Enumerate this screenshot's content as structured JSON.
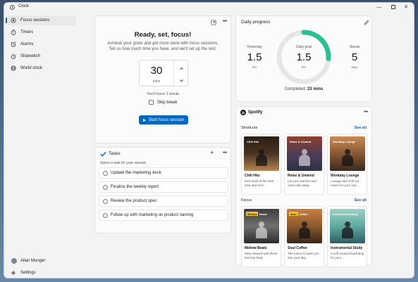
{
  "window": {
    "title": "Clock",
    "controls": {
      "minimize": "—",
      "close": "✕"
    }
  },
  "sidebar": {
    "items": [
      {
        "label": "Focus sessions",
        "icon": "focus-icon",
        "active": true
      },
      {
        "label": "Timers",
        "icon": "timer-icon",
        "active": false
      },
      {
        "label": "Alarms",
        "icon": "alarm-icon",
        "active": false
      },
      {
        "label": "Stopwatch",
        "icon": "stopwatch-icon",
        "active": false
      },
      {
        "label": "World clock",
        "icon": "globe-icon",
        "active": false
      }
    ],
    "user_name": "Allan Munger",
    "settings_label": "Settings"
  },
  "focus": {
    "title": "Ready, set, focus!",
    "description_line1": "Achieve your goals and get more done with focus sessions.",
    "description_line2": "Tell us how much time you have, and we'll set up the rest.",
    "minutes_value": "30",
    "minutes_unit": "mins",
    "break_note": "You'll have 1 break",
    "skip_break_label": "Skip break",
    "skip_break_checked": false,
    "start_button": "Start focus session"
  },
  "tasks": {
    "title": "Tasks",
    "subtitle": "Select a task for your session",
    "items": [
      "Update the marketing deck",
      "Finalize the weekly report",
      "Review the product spec",
      "Follow up with marketing on product naming"
    ]
  },
  "daily_progress": {
    "title": "Daily progress",
    "yesterday_label": "Yesterday",
    "yesterday_value": "1.5",
    "yesterday_unit": "hrs",
    "goal_label": "Daily goal",
    "goal_value": "1.5",
    "goal_unit": "hrs",
    "streak_label": "Streak",
    "streak_value": "5",
    "streak_unit": "days",
    "completed_prefix": "Completed:",
    "completed_value": "23 mins",
    "goal_fraction": 0.26,
    "accent_color": "#2bbf94"
  },
  "spotify": {
    "brand": "Spotify",
    "shortcuts_title": "Shortcuts",
    "focus_title": "Focus",
    "see_all": "See all",
    "shortcuts": [
      {
        "title": "Chill Hits",
        "desc": "Kick back to the best new and rece...",
        "art_label": "Chill Hits"
      },
      {
        "title": "Relax & Unwind",
        "desc": "Let your worries and cares slip away.",
        "art_label": "Relax & Unwind"
      },
      {
        "title": "Workday Lounge",
        "desc": "Lounge and chill out music for your wor...",
        "art_label": "Workday Lounge"
      }
    ],
    "focus_items": [
      {
        "title": "Mellow Beats",
        "desc": "Stay relaxed with these low-key beat...",
        "art_label": "Beats",
        "badge": "Mellow"
      },
      {
        "title": "Soul Coffee",
        "desc": "The tunes to ease you into your day.",
        "art_label": "Coffee",
        "badge": "Soul"
      },
      {
        "title": "Instrumental Study",
        "desc": "A soft musical backdrop for your ...",
        "art_label": "Instrumental Study"
      }
    ]
  }
}
